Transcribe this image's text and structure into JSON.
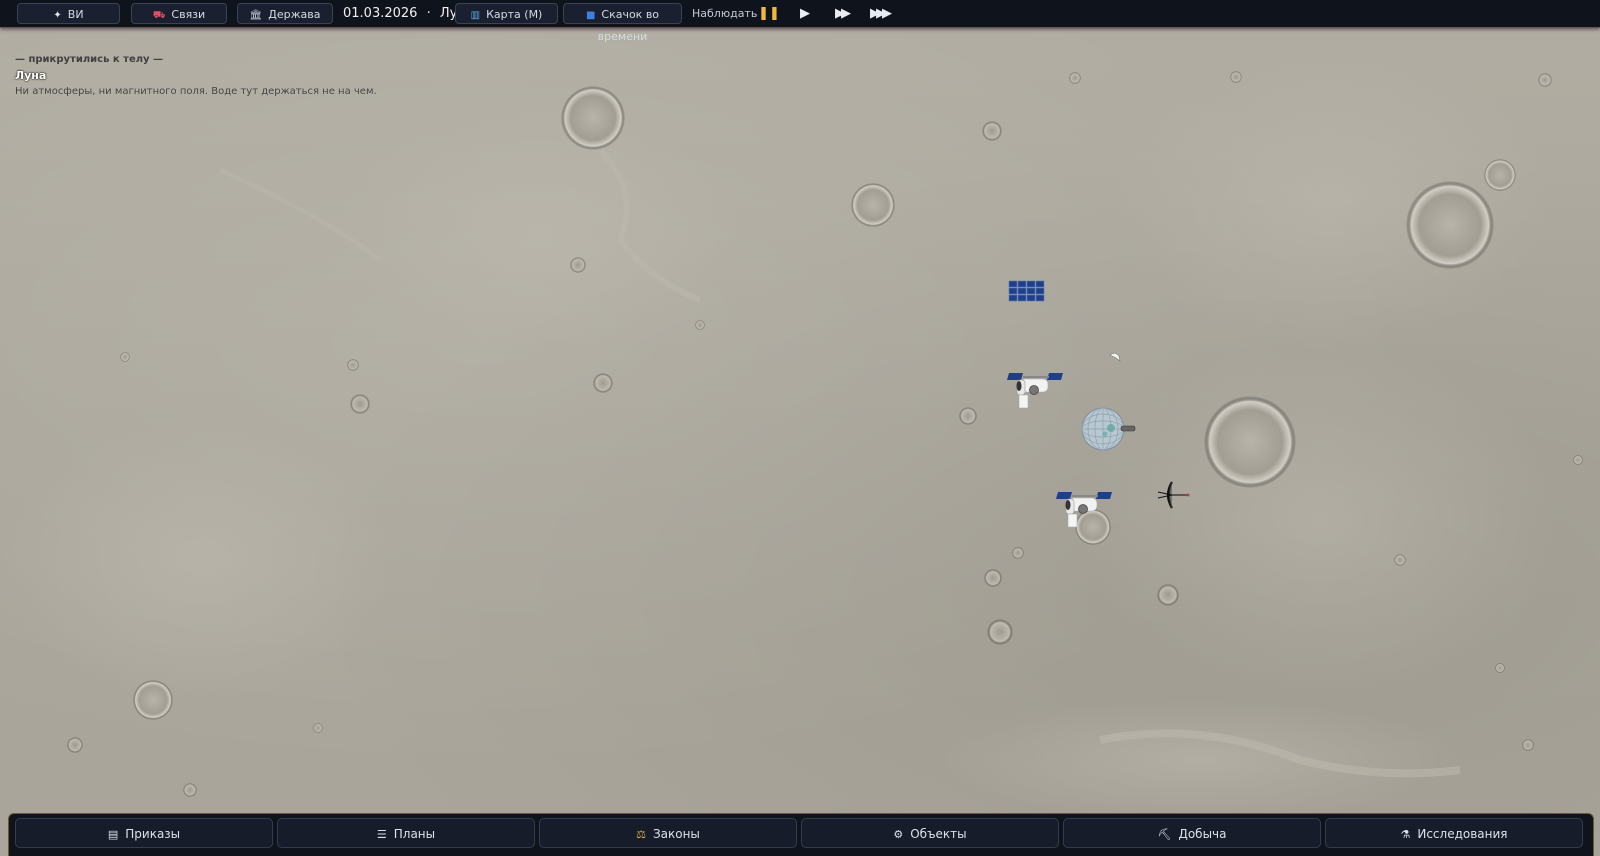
{
  "topbar": {
    "vi_label": "ВИ",
    "vi_icon": "sparkle-icon",
    "links_label": "Связи",
    "links_icon": "links-icon",
    "state_label": "Держава",
    "state_icon": "government-building-icon",
    "date": "01.03.2026",
    "separator": "·",
    "body": "Луна",
    "map_label": "Карта (M)",
    "map_icon": "map-icon",
    "timejump_label": "Скачок во времени",
    "timejump_icon": "time-jump-icon",
    "observe_label": "Наблюдать",
    "speeds": [
      {
        "name": "pause",
        "glyph": "❚❚",
        "active": true,
        "color": "#f0b840"
      },
      {
        "name": "play",
        "glyph": "▶",
        "active": false,
        "color": "#e9ecf2"
      },
      {
        "name": "fast",
        "glyph": "▶▶",
        "active": false,
        "color": "#e9ecf2"
      },
      {
        "name": "fastest",
        "glyph": "▶▶▶",
        "active": false,
        "color": "#e9ecf2"
      }
    ]
  },
  "info": {
    "header": "— прикрутились к телу —",
    "name": "Луна",
    "description": "Ни атмосферы, ни магнитного поля. Воде тут держаться не на чем."
  },
  "objects": [
    {
      "name": "solar-array-icon",
      "kind": "solar-array"
    },
    {
      "name": "small-probe-icon",
      "kind": "probe"
    },
    {
      "name": "space-telescope-icon",
      "kind": "telescope"
    },
    {
      "name": "orbital-habitat-icon",
      "kind": "habitat"
    },
    {
      "name": "space-telescope-icon",
      "kind": "telescope"
    },
    {
      "name": "antenna-dish-icon",
      "kind": "antenna"
    }
  ],
  "bottombar": {
    "orders_label": "Приказы",
    "orders_icon": "orders-icon",
    "plans_label": "Планы",
    "plans_icon": "list-icon",
    "laws_label": "Законы",
    "laws_icon": "scales-icon",
    "objects_label": "Объекты",
    "objects_icon": "gear-icon",
    "mining_label": "Добыча",
    "mining_icon": "pickaxe-icon",
    "research_label": "Исследования",
    "research_icon": "flask-icon"
  },
  "colors": {
    "bar_bg": "#0f131c",
    "bar_border": "#6b5a2a",
    "accent_pause": "#f0b840",
    "moon_surface": "#aaa69b",
    "panel_blue": "#1f3f8a"
  }
}
